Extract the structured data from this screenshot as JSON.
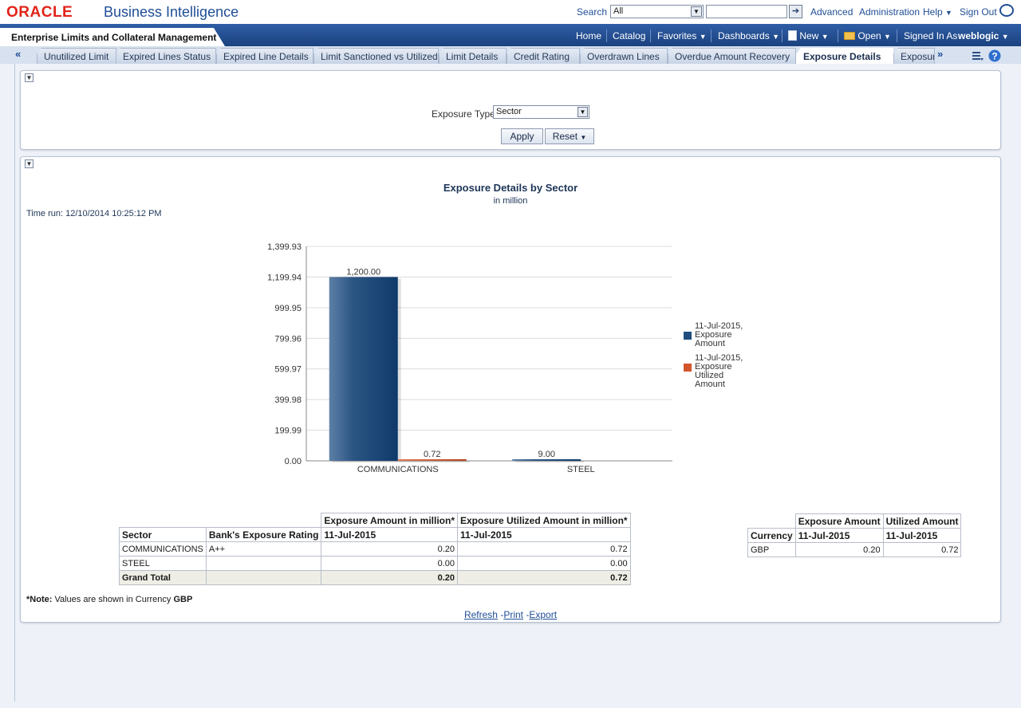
{
  "header": {
    "logo": "ORACLE",
    "app_title": "Business Intelligence",
    "search_label": "Search",
    "search_scope": "All",
    "search_value": "",
    "links": [
      "Advanced",
      "Administration",
      "Help",
      "Sign Out"
    ]
  },
  "nav": {
    "dashboard_title": "Enterprise Limits and Collateral Management",
    "items": [
      "Home",
      "Catalog",
      "Favorites",
      "Dashboards",
      "New",
      "Open"
    ],
    "signed_in_label": "Signed In As",
    "user": "weblogic"
  },
  "tabs": [
    "Unutilized Limit",
    "Expired Lines Status",
    "Expired Line Details",
    "Limit Sanctioned vs Utilized",
    "Limit Details",
    "Credit Rating",
    "Overdrawn Lines",
    "Overdue Amount Recovery",
    "Exposure Details",
    "Exposure"
  ],
  "active_tab": "Exposure Details",
  "prompt": {
    "label": "Exposure Type",
    "value": "Sector",
    "apply": "Apply",
    "reset": "Reset"
  },
  "report": {
    "title": "Exposure Details by Sector",
    "subtitle": "in million",
    "time_run": "Time run: 12/10/2014 10:25:12 PM",
    "note_label": "*Note:",
    "note_text": "Values are shown in Currency",
    "note_currency": "GBP",
    "links": [
      "Refresh",
      "Print",
      "Export"
    ]
  },
  "chart_data": {
    "type": "bar",
    "categories": [
      "COMMUNICATIONS",
      "STEEL"
    ],
    "series": [
      {
        "name": "11-Jul-2015, Exposure Amount",
        "values": [
          1200.0,
          9.0
        ],
        "labels": [
          "1,200.00",
          "9.00"
        ],
        "color": "#1f4e7d"
      },
      {
        "name": "11-Jul-2015, Exposure Utilized Amount",
        "values": [
          0.72,
          0.0
        ],
        "labels": [
          "0.72",
          ""
        ],
        "color": "#d3552c"
      }
    ],
    "yticks": [
      "0.00",
      "199.99",
      "399.98",
      "599.97",
      "799.96",
      "999.95",
      "1,199.94",
      "1,399.93"
    ],
    "ylim": [
      0,
      1399.93
    ],
    "legend_position": "right",
    "grid": true
  },
  "table_main": {
    "group_headers": [
      "Exposure Amount in million*",
      "Exposure Utilized Amount in million*"
    ],
    "columns": [
      "Sector",
      "Bank's Exposure Rating",
      "11-Jul-2015",
      "11-Jul-2015"
    ],
    "rows": [
      [
        "COMMUNICATIONS",
        "A++",
        "0.20",
        "0.72"
      ],
      [
        "STEEL",
        "",
        "0.00",
        "0.00"
      ]
    ],
    "total": [
      "Grand Total",
      "",
      "0.20",
      "0.72"
    ]
  },
  "table_currency": {
    "group_headers": [
      "Exposure Amount",
      "Utilized Amount"
    ],
    "columns": [
      "Currency",
      "11-Jul-2015",
      "11-Jul-2015"
    ],
    "rows": [
      [
        "GBP",
        "0.20",
        "0.72"
      ]
    ]
  }
}
